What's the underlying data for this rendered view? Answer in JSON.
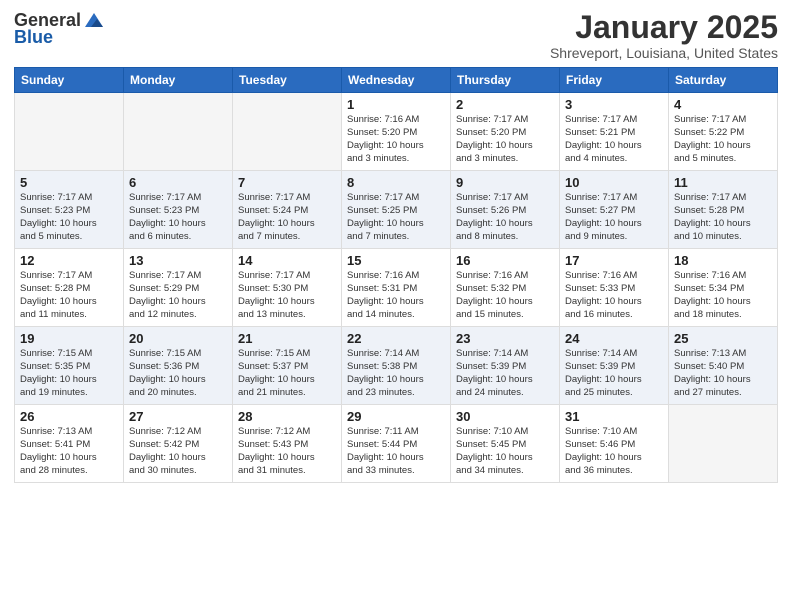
{
  "logo": {
    "general": "General",
    "blue": "Blue"
  },
  "header": {
    "title": "January 2025",
    "subtitle": "Shreveport, Louisiana, United States"
  },
  "weekdays": [
    "Sunday",
    "Monday",
    "Tuesday",
    "Wednesday",
    "Thursday",
    "Friday",
    "Saturday"
  ],
  "weeks": [
    [
      {
        "day": "",
        "info": ""
      },
      {
        "day": "",
        "info": ""
      },
      {
        "day": "",
        "info": ""
      },
      {
        "day": "1",
        "info": "Sunrise: 7:16 AM\nSunset: 5:20 PM\nDaylight: 10 hours\nand 3 minutes."
      },
      {
        "day": "2",
        "info": "Sunrise: 7:17 AM\nSunset: 5:20 PM\nDaylight: 10 hours\nand 3 minutes."
      },
      {
        "day": "3",
        "info": "Sunrise: 7:17 AM\nSunset: 5:21 PM\nDaylight: 10 hours\nand 4 minutes."
      },
      {
        "day": "4",
        "info": "Sunrise: 7:17 AM\nSunset: 5:22 PM\nDaylight: 10 hours\nand 5 minutes."
      }
    ],
    [
      {
        "day": "5",
        "info": "Sunrise: 7:17 AM\nSunset: 5:23 PM\nDaylight: 10 hours\nand 5 minutes."
      },
      {
        "day": "6",
        "info": "Sunrise: 7:17 AM\nSunset: 5:23 PM\nDaylight: 10 hours\nand 6 minutes."
      },
      {
        "day": "7",
        "info": "Sunrise: 7:17 AM\nSunset: 5:24 PM\nDaylight: 10 hours\nand 7 minutes."
      },
      {
        "day": "8",
        "info": "Sunrise: 7:17 AM\nSunset: 5:25 PM\nDaylight: 10 hours\nand 7 minutes."
      },
      {
        "day": "9",
        "info": "Sunrise: 7:17 AM\nSunset: 5:26 PM\nDaylight: 10 hours\nand 8 minutes."
      },
      {
        "day": "10",
        "info": "Sunrise: 7:17 AM\nSunset: 5:27 PM\nDaylight: 10 hours\nand 9 minutes."
      },
      {
        "day": "11",
        "info": "Sunrise: 7:17 AM\nSunset: 5:28 PM\nDaylight: 10 hours\nand 10 minutes."
      }
    ],
    [
      {
        "day": "12",
        "info": "Sunrise: 7:17 AM\nSunset: 5:28 PM\nDaylight: 10 hours\nand 11 minutes."
      },
      {
        "day": "13",
        "info": "Sunrise: 7:17 AM\nSunset: 5:29 PM\nDaylight: 10 hours\nand 12 minutes."
      },
      {
        "day": "14",
        "info": "Sunrise: 7:17 AM\nSunset: 5:30 PM\nDaylight: 10 hours\nand 13 minutes."
      },
      {
        "day": "15",
        "info": "Sunrise: 7:16 AM\nSunset: 5:31 PM\nDaylight: 10 hours\nand 14 minutes."
      },
      {
        "day": "16",
        "info": "Sunrise: 7:16 AM\nSunset: 5:32 PM\nDaylight: 10 hours\nand 15 minutes."
      },
      {
        "day": "17",
        "info": "Sunrise: 7:16 AM\nSunset: 5:33 PM\nDaylight: 10 hours\nand 16 minutes."
      },
      {
        "day": "18",
        "info": "Sunrise: 7:16 AM\nSunset: 5:34 PM\nDaylight: 10 hours\nand 18 minutes."
      }
    ],
    [
      {
        "day": "19",
        "info": "Sunrise: 7:15 AM\nSunset: 5:35 PM\nDaylight: 10 hours\nand 19 minutes."
      },
      {
        "day": "20",
        "info": "Sunrise: 7:15 AM\nSunset: 5:36 PM\nDaylight: 10 hours\nand 20 minutes."
      },
      {
        "day": "21",
        "info": "Sunrise: 7:15 AM\nSunset: 5:37 PM\nDaylight: 10 hours\nand 21 minutes."
      },
      {
        "day": "22",
        "info": "Sunrise: 7:14 AM\nSunset: 5:38 PM\nDaylight: 10 hours\nand 23 minutes."
      },
      {
        "day": "23",
        "info": "Sunrise: 7:14 AM\nSunset: 5:39 PM\nDaylight: 10 hours\nand 24 minutes."
      },
      {
        "day": "24",
        "info": "Sunrise: 7:14 AM\nSunset: 5:39 PM\nDaylight: 10 hours\nand 25 minutes."
      },
      {
        "day": "25",
        "info": "Sunrise: 7:13 AM\nSunset: 5:40 PM\nDaylight: 10 hours\nand 27 minutes."
      }
    ],
    [
      {
        "day": "26",
        "info": "Sunrise: 7:13 AM\nSunset: 5:41 PM\nDaylight: 10 hours\nand 28 minutes."
      },
      {
        "day": "27",
        "info": "Sunrise: 7:12 AM\nSunset: 5:42 PM\nDaylight: 10 hours\nand 30 minutes."
      },
      {
        "day": "28",
        "info": "Sunrise: 7:12 AM\nSunset: 5:43 PM\nDaylight: 10 hours\nand 31 minutes."
      },
      {
        "day": "29",
        "info": "Sunrise: 7:11 AM\nSunset: 5:44 PM\nDaylight: 10 hours\nand 33 minutes."
      },
      {
        "day": "30",
        "info": "Sunrise: 7:10 AM\nSunset: 5:45 PM\nDaylight: 10 hours\nand 34 minutes."
      },
      {
        "day": "31",
        "info": "Sunrise: 7:10 AM\nSunset: 5:46 PM\nDaylight: 10 hours\nand 36 minutes."
      },
      {
        "day": "",
        "info": ""
      }
    ]
  ]
}
